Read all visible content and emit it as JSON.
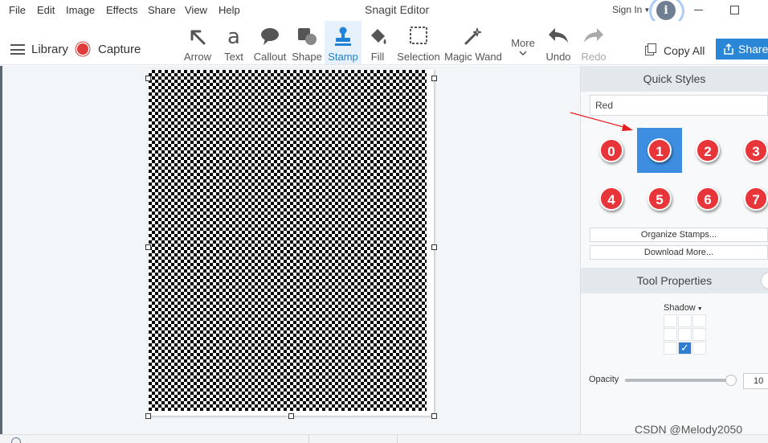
{
  "menu": {
    "items": [
      "File",
      "Edit",
      "Image",
      "Effects",
      "Share",
      "View",
      "Help"
    ],
    "app_title": "Snagit Editor",
    "sign_in": "Sign In"
  },
  "toolbar": {
    "library_label": "Library",
    "capture_label": "Capture",
    "tools": [
      {
        "label": "Arrow",
        "icon": "arrow-icon"
      },
      {
        "label": "Text",
        "icon": "text-icon"
      },
      {
        "label": "Callout",
        "icon": "callout-icon"
      },
      {
        "label": "Shape",
        "icon": "shape-icon"
      },
      {
        "label": "Stamp",
        "icon": "stamp-icon",
        "active": true
      },
      {
        "label": "Fill",
        "icon": "fill-icon"
      },
      {
        "label": "Selection",
        "icon": "selection-icon"
      },
      {
        "label": "Magic Wand",
        "icon": "magic-wand-icon"
      },
      {
        "label": "More",
        "icon": "more-icon"
      },
      {
        "label": "Undo",
        "icon": "undo-icon"
      },
      {
        "label": "Redo",
        "icon": "redo-icon",
        "disabled": true
      }
    ],
    "copy_all_label": "Copy All",
    "share_label": "Share"
  },
  "quick_styles": {
    "header": "Quick Styles",
    "style_name": "Red",
    "stamps": [
      "0",
      "1",
      "2",
      "3",
      "4",
      "5",
      "6",
      "7"
    ],
    "selected_stamp": "1",
    "organize_label": "Organize Stamps...",
    "download_label": "Download More..."
  },
  "tool_properties": {
    "header": "Tool Properties",
    "shadow_label": "Shadow",
    "opacity_label": "Opacity",
    "opacity_value": "10"
  },
  "colors": {
    "accent": "#2a86d6",
    "stamp_red": "#e8353a",
    "selected_cell": "#3d8ee0"
  },
  "watermark": "CSDN @Melody2050"
}
